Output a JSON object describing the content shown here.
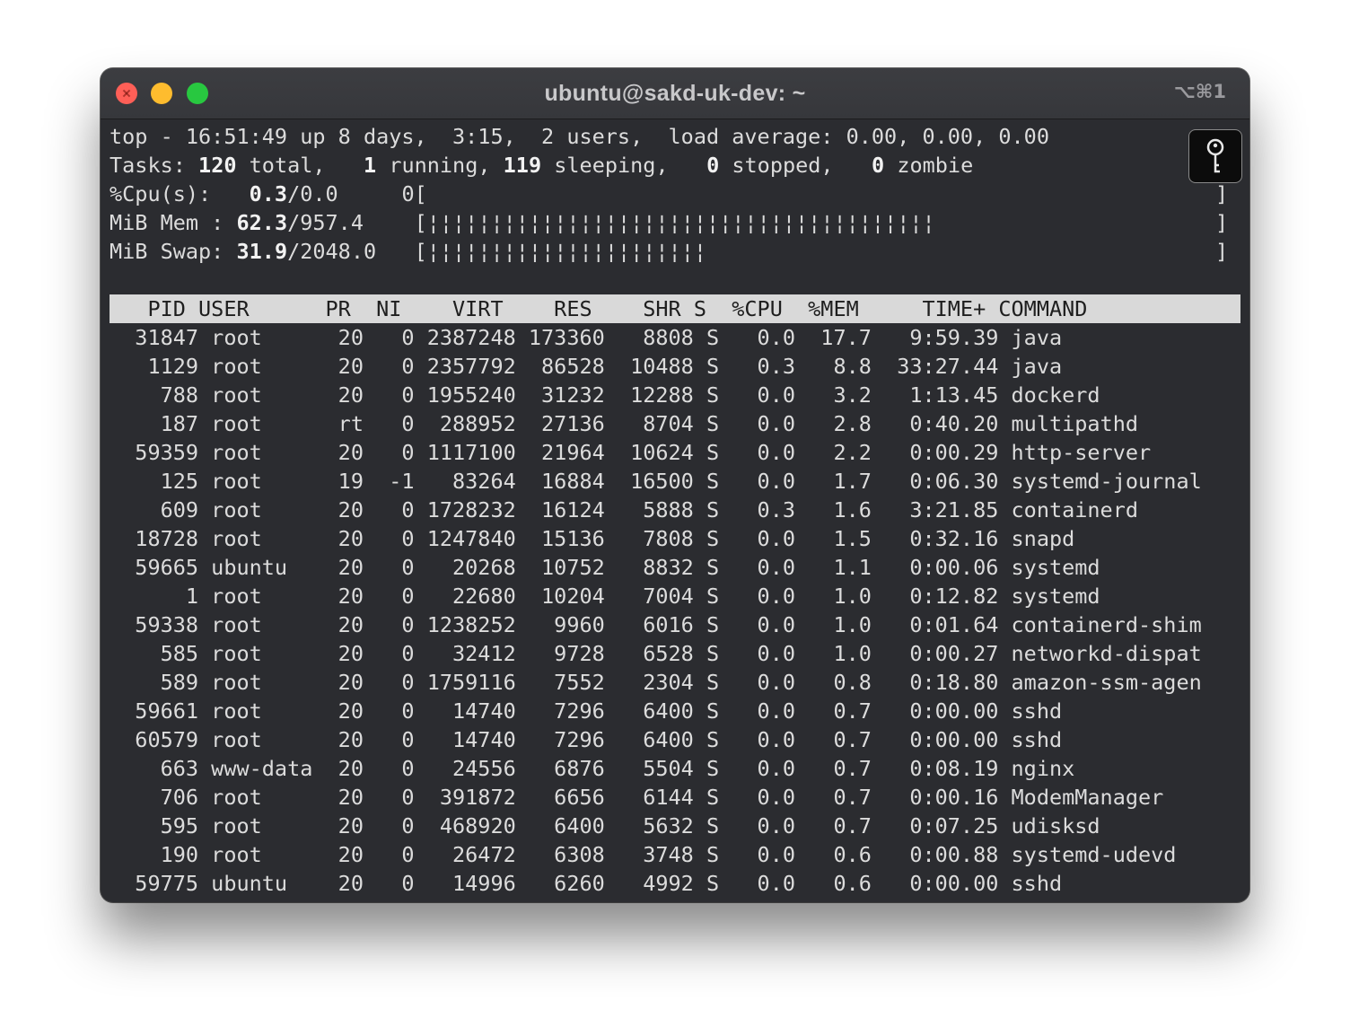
{
  "window": {
    "title": "ubuntu@sakd-uk-dev: ~",
    "shortcut": "⌥⌘1"
  },
  "icons": {
    "close": "close-icon",
    "minimize": "minimize-icon",
    "maximize": "maximize-icon",
    "key": "key-icon"
  },
  "top": {
    "summary": {
      "prefix": "top - 16:51:49 up 8 days,  3:15,  2 users,  load average: 0.00, 0.00, 0.00"
    },
    "tasks": {
      "label": "Tasks:",
      "total": "120",
      "total_label": "total,",
      "running": "1",
      "running_label": "running,",
      "sleeping": "119",
      "sleeping_label": "sleeping,",
      "stopped": "0",
      "stopped_label": "stopped,",
      "zombie": "0",
      "zombie_label": "zombie"
    },
    "cpu": {
      "label": "%Cpu(s):",
      "value": "0.3",
      "rest": "/0.0",
      "bar_prefix": "0[",
      "bar": "",
      "close": "]"
    },
    "mem": {
      "label": "MiB Mem :",
      "used": "62.3",
      "total": "/957.4",
      "bar": "[¦¦¦¦¦¦¦¦¦¦¦¦¦¦¦¦¦¦¦¦¦¦¦¦¦¦¦¦¦¦¦¦¦¦¦¦¦¦¦¦",
      "close": "]"
    },
    "swap": {
      "label": "MiB Swap:",
      "used": "31.9",
      "total": "/2048.0",
      "bar": "[¦¦¦¦¦¦¦¦¦¦¦¦¦¦¦¦¦¦¦¦¦¦",
      "close": "]"
    }
  },
  "table": {
    "header": "   PID USER      PR  NI    VIRT    RES    SHR S  %CPU  %MEM     TIME+ COMMAND",
    "rows": [
      "  31847 root      20   0 2387248 173360   8808 S   0.0  17.7   9:59.39 java",
      "   1129 root      20   0 2357792  86528  10488 S   0.3   8.8  33:27.44 java",
      "    788 root      20   0 1955240  31232  12288 S   0.0   3.2   1:13.45 dockerd",
      "    187 root      rt   0  288952  27136   8704 S   0.0   2.8   0:40.20 multipathd",
      "  59359 root      20   0 1117100  21964  10624 S   0.0   2.2   0:00.29 http-server",
      "    125 root      19  -1   83264  16884  16500 S   0.0   1.7   0:06.30 systemd-journal",
      "    609 root      20   0 1728232  16124   5888 S   0.3   1.6   3:21.85 containerd",
      "  18728 root      20   0 1247840  15136   7808 S   0.0   1.5   0:32.16 snapd",
      "  59665 ubuntu    20   0   20268  10752   8832 S   0.0   1.1   0:00.06 systemd",
      "      1 root      20   0   22680  10204   7004 S   0.0   1.0   0:12.82 systemd",
      "  59338 root      20   0 1238252   9960   6016 S   0.0   1.0   0:01.64 containerd-shim",
      "    585 root      20   0   32412   9728   6528 S   0.0   1.0   0:00.27 networkd-dispat",
      "    589 root      20   0 1759116   7552   2304 S   0.0   0.8   0:18.80 amazon-ssm-agen",
      "  59661 root      20   0   14740   7296   6400 S   0.0   0.7   0:00.00 sshd",
      "  60579 root      20   0   14740   7296   6400 S   0.0   0.7   0:00.00 sshd",
      "    663 www-data  20   0   24556   6876   5504 S   0.0   0.7   0:08.19 nginx",
      "    706 root      20   0  391872   6656   6144 S   0.0   0.7   0:00.16 ModemManager",
      "    595 root      20   0  468920   6400   5632 S   0.0   0.7   0:07.25 udisksd",
      "    190 root      20   0   26472   6308   3748 S   0.0   0.6   0:00.88 systemd-udevd",
      "  59775 ubuntu    20   0   14996   6260   4992 S   0.0   0.6   0:00.00 sshd"
    ]
  }
}
